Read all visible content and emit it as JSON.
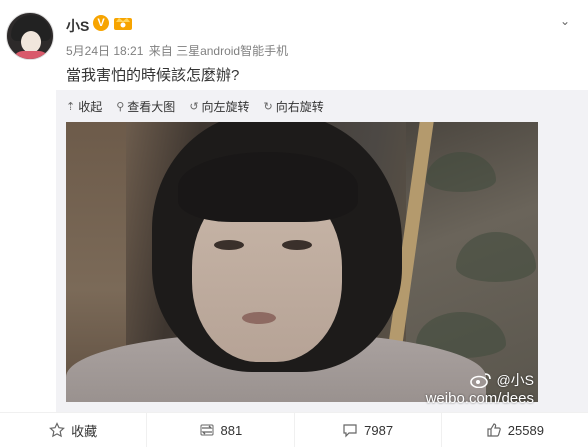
{
  "post": {
    "author": "小S",
    "verified_mark": "V",
    "date": "5月24日 18:21",
    "source": "来自 三星android智能手机",
    "text": "當我害怕的時候該怎麼辦?"
  },
  "toolbar": {
    "collapse": "收起",
    "view_large": "查看大图",
    "rotate_left": "向左旋转",
    "rotate_right": "向右旋转"
  },
  "watermark": {
    "name": "@小S",
    "site": "weibo.com/dees"
  },
  "actions": {
    "favorite": "收藏",
    "repost": "881",
    "comment": "7987",
    "like": "25589"
  },
  "colors": {
    "verified": "#f7a400",
    "meta": "#808080"
  }
}
